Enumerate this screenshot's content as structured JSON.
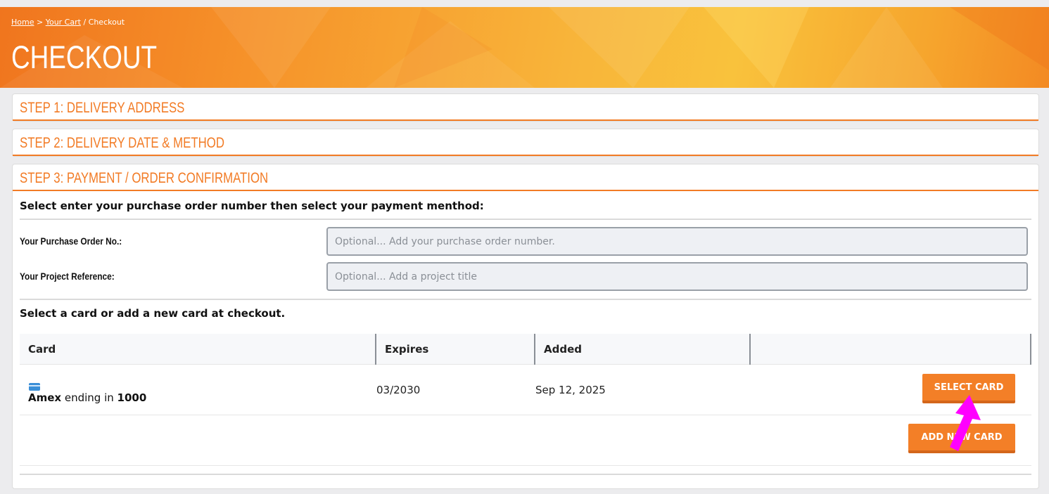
{
  "breadcrumb": {
    "home": "Home",
    "sep1": " > ",
    "cart": "Your Cart",
    "sep2": " / ",
    "current": "Checkout"
  },
  "page_title": "CHECKOUT",
  "steps": [
    {
      "title": "STEP 1: DELIVERY ADDRESS"
    },
    {
      "title": "STEP 2: DELIVERY DATE & METHOD"
    },
    {
      "title": "STEP 3: PAYMENT / ORDER CONFIRMATION"
    }
  ],
  "payment": {
    "instruction": "Select enter your purchase order number then select your payment menthod:",
    "po_label": "Your Purchase Order No.:",
    "po_placeholder": "Optional... Add your purchase order number.",
    "project_label": "Your Project Reference:",
    "project_placeholder": "Optional... Add a project title",
    "cards_instruction": "Select a card or add a new card at checkout."
  },
  "cards_table": {
    "headers": [
      "Card",
      "Expires",
      "Added",
      ""
    ],
    "rows": [
      {
        "brand": "Amex",
        "ending_text": " ending in ",
        "last4": "1000",
        "expires": "03/2030",
        "added": "Sep 12, 2025",
        "action": "SELECT CARD"
      }
    ],
    "add_button": "ADD NEW CARD"
  },
  "colors": {
    "accent": "#f27b25",
    "arrow": "#ff00ff"
  },
  "icons": {
    "card": "credit-card-icon",
    "pointer": "arrow-annotation-icon"
  }
}
